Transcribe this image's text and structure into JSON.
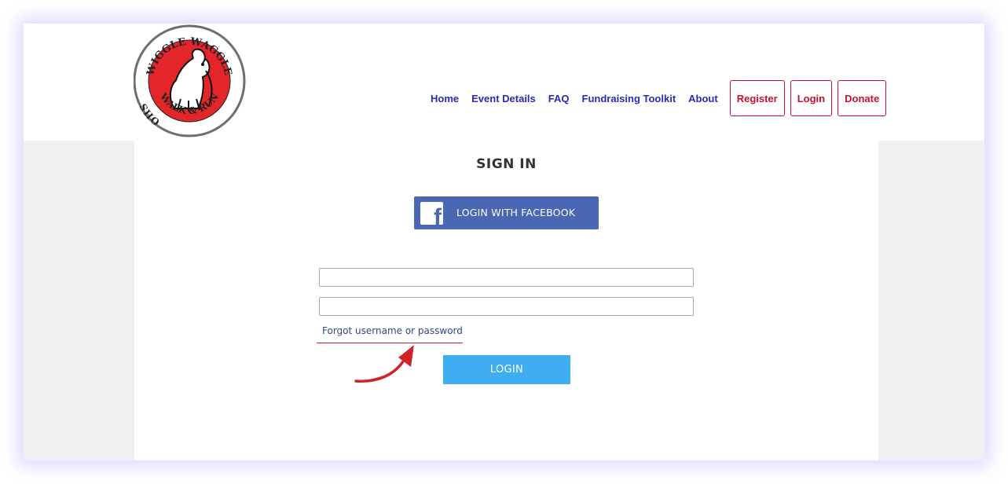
{
  "brand": {
    "logo_top_text": "WIGGLE WAGGLE",
    "logo_left_text": "OHS",
    "logo_bottom_text": "WALK & RUN"
  },
  "nav": {
    "links": [
      "Home",
      "Event Details",
      "FAQ",
      "Fundraising Toolkit",
      "About"
    ],
    "buttons": [
      "Register",
      "Login",
      "Donate"
    ]
  },
  "signin": {
    "title": "SIGN IN",
    "facebook_label": "LOGIN WITH FACEBOOK",
    "facebook_icon": "facebook-icon",
    "username_value": "",
    "password_value": "",
    "forgot_label": "Forgot username or password",
    "login_label": "LOGIN"
  },
  "colors": {
    "nav_link": "#2a2ab8",
    "nav_button": "#c8102e",
    "facebook_blue": "#4a67b3",
    "login_blue": "#3eaef0",
    "annotation_red": "#d2232a"
  }
}
